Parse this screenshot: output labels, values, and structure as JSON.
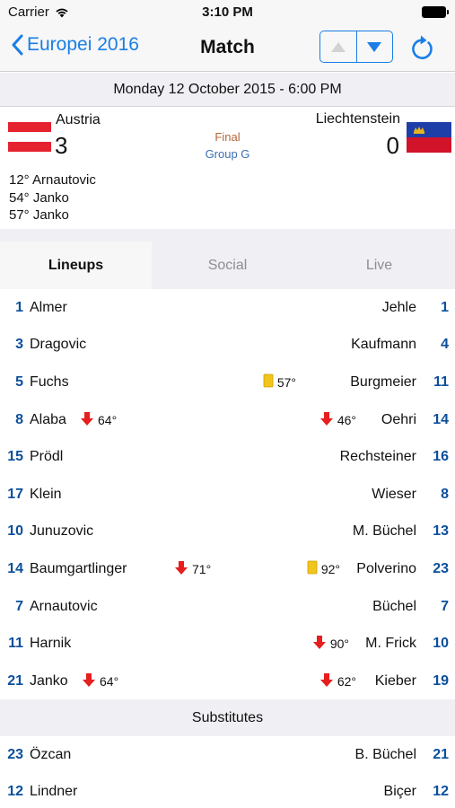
{
  "status_bar": {
    "carrier": "Carrier",
    "time": "3:10 PM"
  },
  "nav": {
    "back_label": "Europei 2016",
    "title": "Match"
  },
  "match": {
    "date": "Monday 12 October 2015 - 6:00 PM",
    "home": {
      "name": "Austria",
      "score": "3"
    },
    "away": {
      "name": "Liechtenstein",
      "score": "0"
    },
    "status": "Final",
    "group": "Group G",
    "goals": [
      "12° Arnautovic",
      "54° Janko",
      "57° Janko"
    ]
  },
  "tabs": [
    {
      "label": "Lineups",
      "active": true
    },
    {
      "label": "Social",
      "active": false
    },
    {
      "label": "Live",
      "active": false
    }
  ],
  "lineups": [
    {
      "home_num": "1",
      "home_name": "Almer",
      "away_name": "Jehle",
      "away_num": "1"
    },
    {
      "home_num": "3",
      "home_name": "Dragovic",
      "away_name": "Kaufmann",
      "away_num": "4"
    },
    {
      "home_num": "5",
      "home_name": "Fuchs",
      "away_name": "Burgmeier",
      "away_num": "11",
      "away_event": {
        "icon": "yellow-card-icon",
        "minute": "57°"
      }
    },
    {
      "home_num": "8",
      "home_name": "Alaba",
      "home_event": {
        "icon": "sub-out-arrow-icon",
        "minute": "64°"
      },
      "away_name": "Oehri",
      "away_num": "14",
      "away_event": {
        "icon": "sub-out-arrow-icon",
        "minute": "46°"
      }
    },
    {
      "home_num": "15",
      "home_name": "Prödl",
      "away_name": "Rechsteiner",
      "away_num": "16"
    },
    {
      "home_num": "17",
      "home_name": "Klein",
      "away_name": "Wieser",
      "away_num": "8"
    },
    {
      "home_num": "10",
      "home_name": "Junuzovic",
      "away_name": "M. Büchel",
      "away_num": "13"
    },
    {
      "home_num": "14",
      "home_name": "Baumgartlinger",
      "home_event": {
        "icon": "sub-out-arrow-icon",
        "minute": "71°"
      },
      "away_name": "Polverino",
      "away_num": "23",
      "away_event": {
        "icon": "yellow-card-icon",
        "minute": "92°"
      }
    },
    {
      "home_num": "7",
      "home_name": "Arnautovic",
      "away_name": "Büchel",
      "away_num": "7"
    },
    {
      "home_num": "11",
      "home_name": "Harnik",
      "away_name": "M. Frick",
      "away_num": "10",
      "away_event": {
        "icon": "sub-out-arrow-icon",
        "minute": "90°"
      }
    },
    {
      "home_num": "21",
      "home_name": "Janko",
      "home_event": {
        "icon": "sub-out-arrow-icon",
        "minute": "64°"
      },
      "away_name": "Kieber",
      "away_num": "19",
      "away_event": {
        "icon": "sub-out-arrow-icon",
        "minute": "62°"
      }
    }
  ],
  "substitutes_header": "Substitutes",
  "substitutes": [
    {
      "home_num": "23",
      "home_name": "Özcan",
      "away_name": "B. Büchel",
      "away_num": "21"
    },
    {
      "home_num": "12",
      "home_name": "Lindner",
      "away_name": "Biçer",
      "away_num": "12"
    }
  ],
  "colors": {
    "accent": "#1a7ee6",
    "number": "#0b4f9c",
    "status": "#b5663a",
    "group": "#3a6fb5",
    "austria_red": "#e4232f",
    "liechtenstein_blue": "#1f3fa8",
    "liechtenstein_red": "#d3132a"
  }
}
